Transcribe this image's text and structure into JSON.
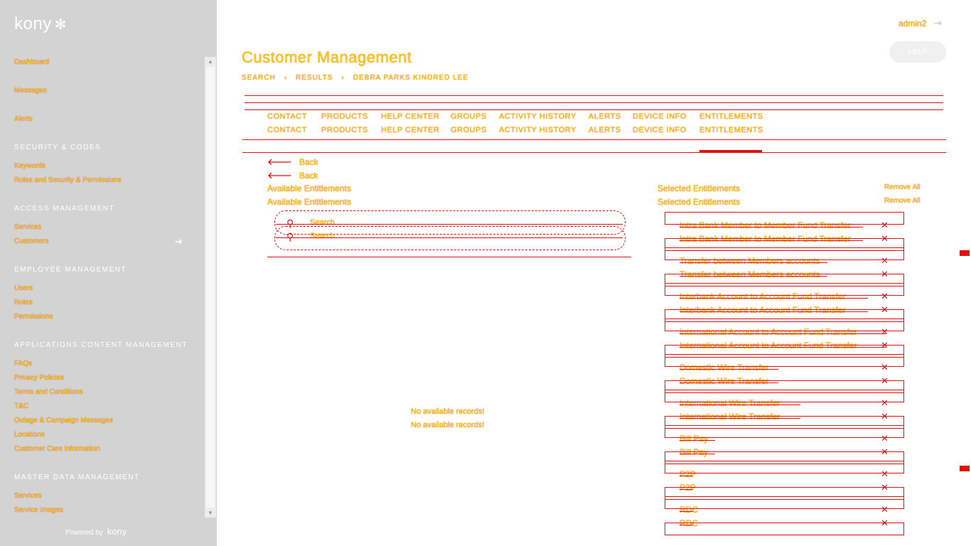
{
  "app": {
    "logo": "kony",
    "user": "admin2",
    "help_label": "HELP"
  },
  "sidebar": {
    "items": [
      {
        "label": "Dashboard",
        "type": "item"
      },
      {
        "label": "Messages",
        "type": "item"
      },
      {
        "label": "Alerts",
        "type": "item"
      },
      {
        "label": "SECURITY & CODES",
        "type": "header"
      },
      {
        "label": "Keywords",
        "type": "item"
      },
      {
        "label": "Roles and Security & Permissions",
        "type": "item"
      },
      {
        "label": "ACCESS MANAGEMENT",
        "type": "header"
      },
      {
        "label": "Services",
        "type": "item"
      },
      {
        "label": "Customers",
        "type": "item"
      },
      {
        "label": "EMPLOYEE MANAGEMENT",
        "type": "header"
      },
      {
        "label": "Users",
        "type": "item"
      },
      {
        "label": "Roles",
        "type": "item"
      },
      {
        "label": "Permissions",
        "type": "item"
      },
      {
        "label": "APPLICATIONS CONTENT MANAGEMENT",
        "type": "header"
      },
      {
        "label": "FAQs",
        "type": "item"
      },
      {
        "label": "Privacy Policies",
        "type": "item"
      },
      {
        "label": "Terms and Conditions",
        "type": "item"
      },
      {
        "label": "T&C",
        "type": "item"
      },
      {
        "label": "Outage & Campaign Messages",
        "type": "item"
      },
      {
        "label": "Locations",
        "type": "item"
      },
      {
        "label": "Customer Care Information",
        "type": "item"
      },
      {
        "label": "MASTER DATA MANAGEMENT",
        "type": "header"
      },
      {
        "label": "Services",
        "type": "item"
      },
      {
        "label": "Service Images",
        "type": "item"
      }
    ],
    "powered_by": "Powered by",
    "powered_logo": "kony"
  },
  "page": {
    "title": "Customer Management",
    "breadcrumb": [
      "SEARCH",
      "RESULTS",
      "DEBRA PARKS KINDRED LEE"
    ]
  },
  "tabs": [
    "CONTACT",
    "PRODUCTS",
    "HELP CENTER",
    "GROUPS",
    "ACTIVITY HISTORY",
    "ALERTS",
    "DEVICE INFO",
    "ENTITLEMENTS"
  ],
  "active_tab": "ENTITLEMENTS",
  "back_label": "Back",
  "available": {
    "title": "Available Entitlements",
    "search_placeholder": "Search",
    "empty_text": "No available records!"
  },
  "selected": {
    "title": "Selected Entitlements",
    "remove_all": "Remove All",
    "items": [
      "Intra Bank Member to Member Fund Transfer",
      "Transfer between Members accounts",
      "Interbank Account to Account Fund Transfer",
      "International Account to Account Fund Transfer",
      "Domestic Wire Transfer",
      "International Wire Transfer",
      "Bill Pay",
      "P2P",
      "RDC"
    ]
  },
  "colors": {
    "accent": "#e01010",
    "text": "#f5d300",
    "sidebar": "#d3d3d3"
  }
}
